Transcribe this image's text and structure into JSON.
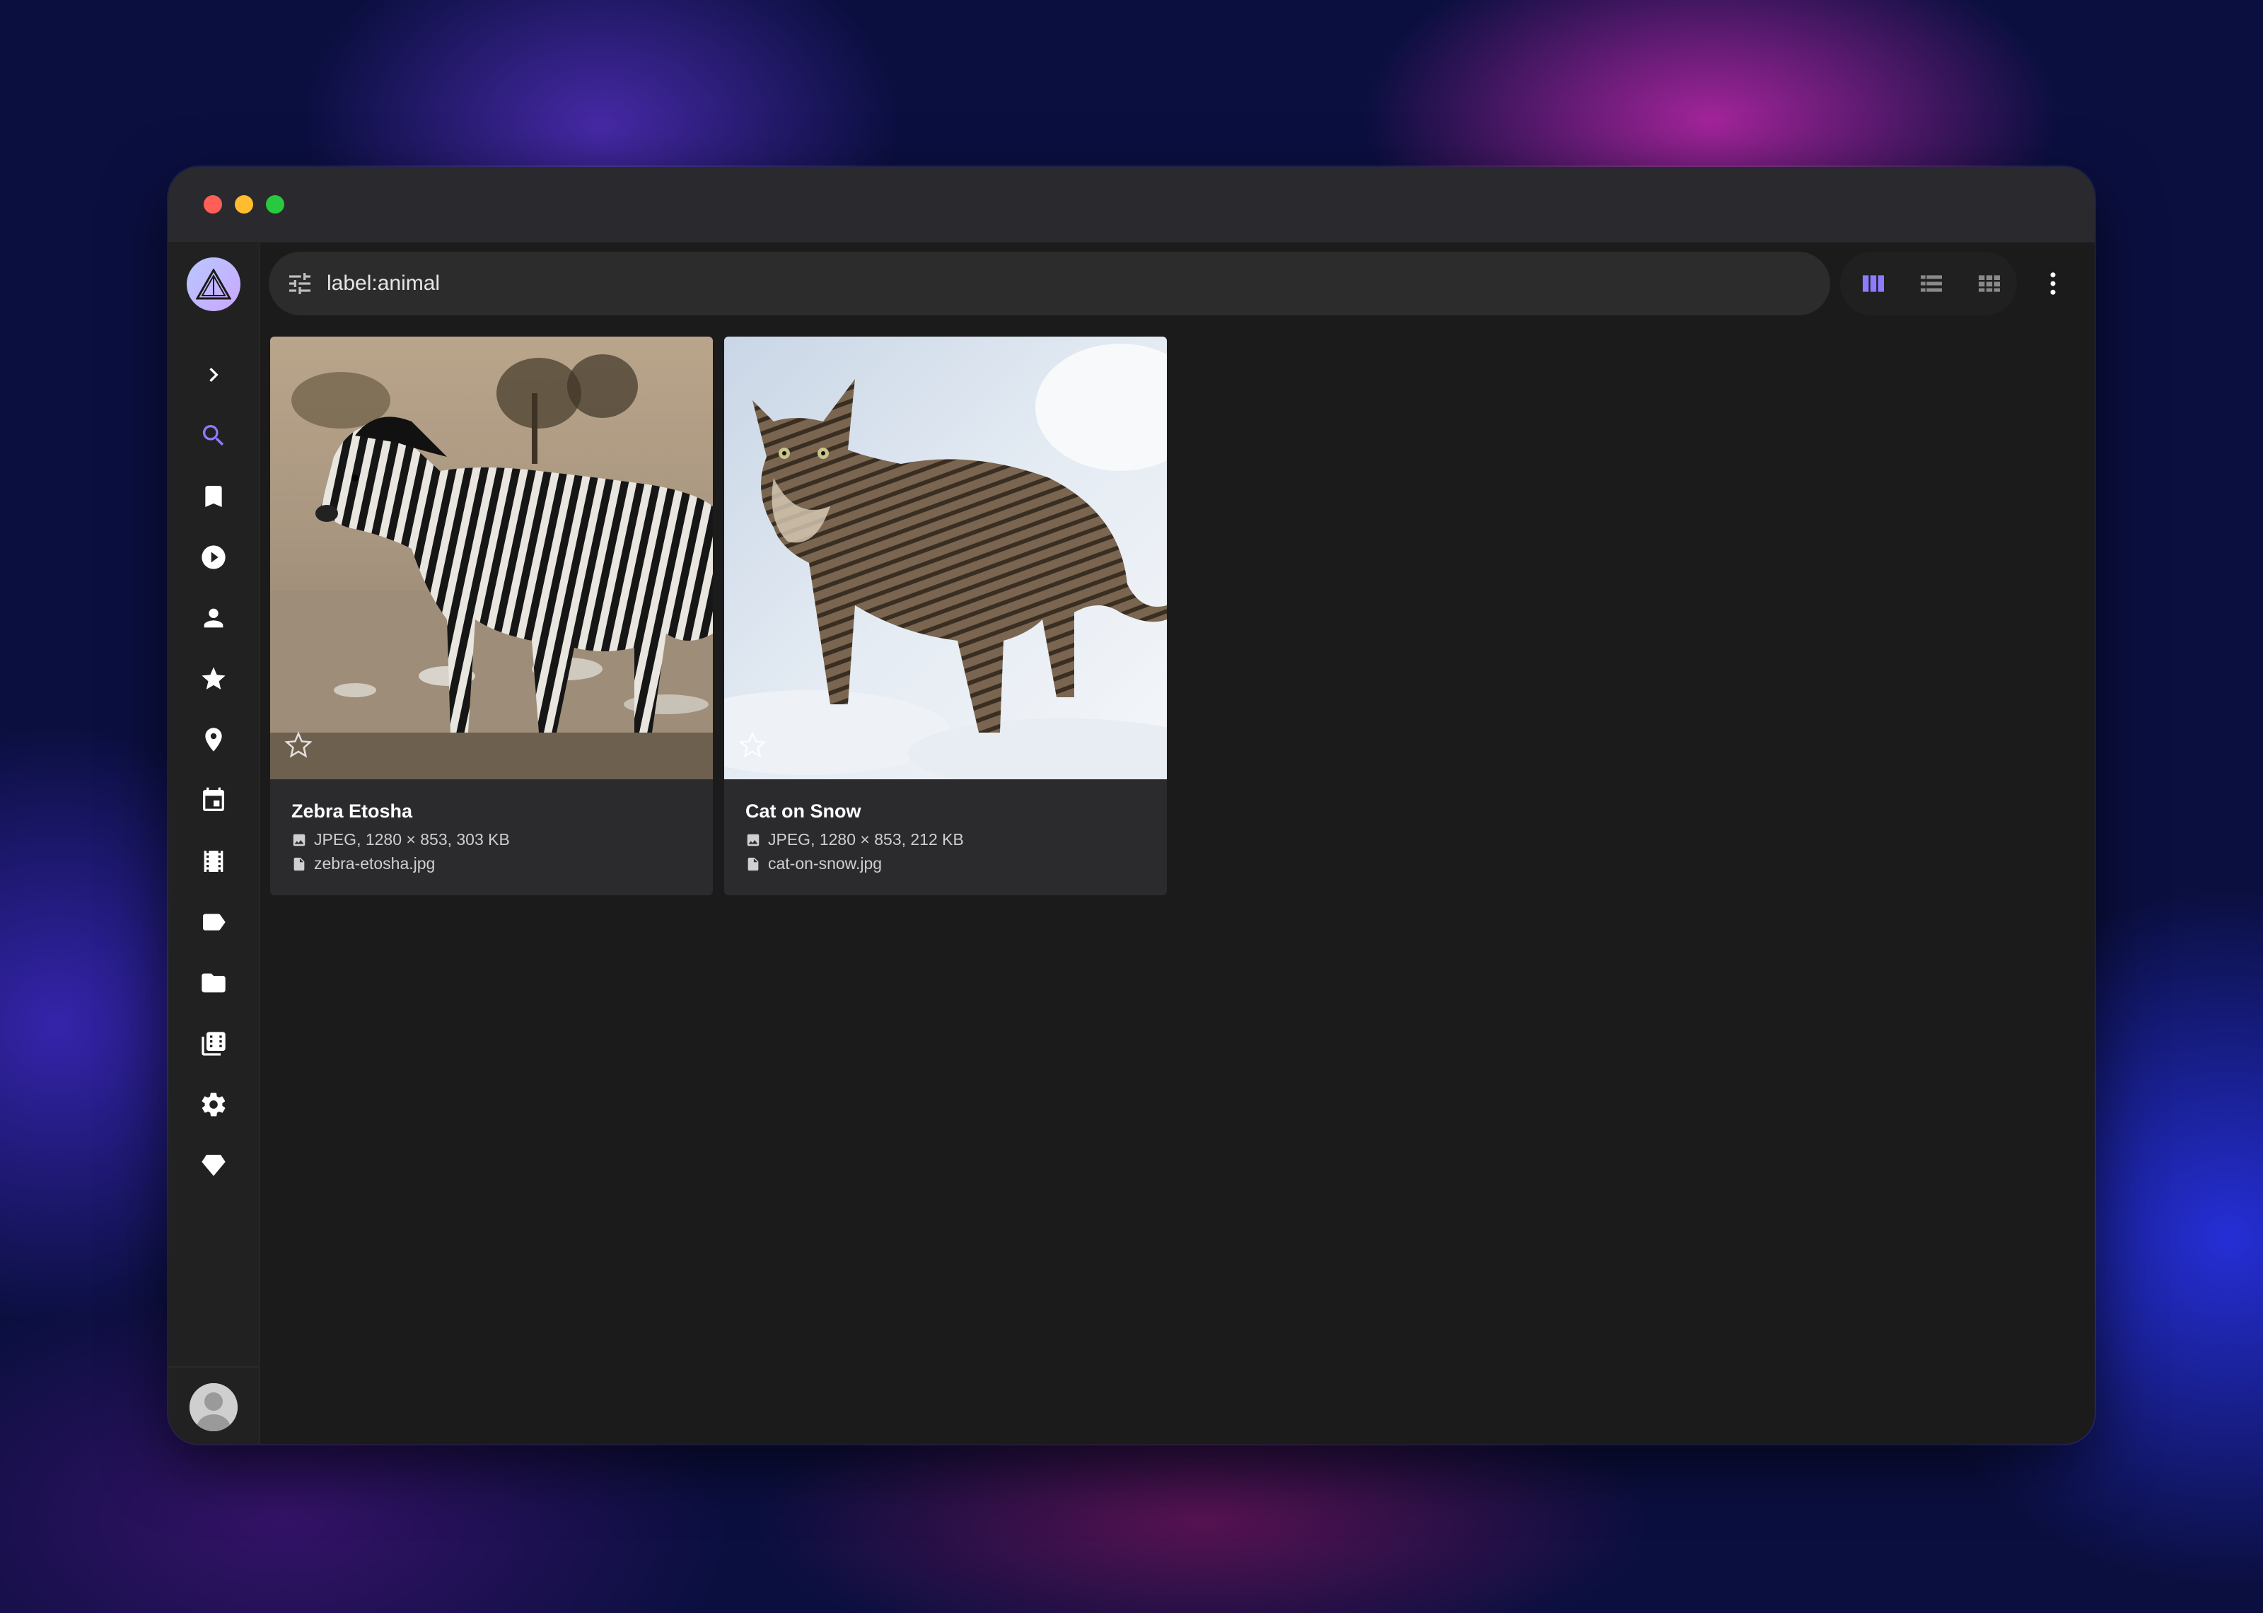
{
  "search": {
    "query": "label:animal"
  },
  "sidebar": {
    "items": [
      {
        "icon": "chevron-right-icon"
      },
      {
        "icon": "search-icon",
        "active": true
      },
      {
        "icon": "bookmark-icon"
      },
      {
        "icon": "play-circle-icon"
      },
      {
        "icon": "person-icon"
      },
      {
        "icon": "star-icon"
      },
      {
        "icon": "location-pin-icon"
      },
      {
        "icon": "calendar-icon"
      },
      {
        "icon": "film-icon"
      },
      {
        "icon": "label-icon"
      },
      {
        "icon": "folder-icon"
      },
      {
        "icon": "library-icon"
      },
      {
        "icon": "settings-icon"
      },
      {
        "icon": "diamond-icon"
      }
    ]
  },
  "view_modes": [
    {
      "icon": "cards-view-icon",
      "active": true
    },
    {
      "icon": "list-view-icon",
      "active": false
    },
    {
      "icon": "mosaic-view-icon",
      "active": false
    }
  ],
  "accent_color": "#8c7bff",
  "photos": [
    {
      "title": "Zebra Etosha",
      "info": "JPEG, 1280 × 853, 303 KB",
      "filename": "zebra-etosha.jpg"
    },
    {
      "title": "Cat on Snow",
      "info": "JPEG, 1280 × 853, 212 KB",
      "filename": "cat-on-snow.jpg"
    }
  ]
}
